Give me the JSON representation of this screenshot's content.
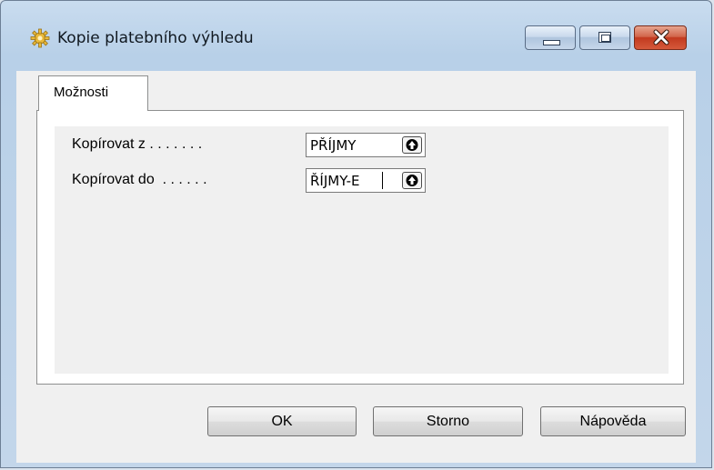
{
  "window": {
    "title": "Kopie platebního výhledu",
    "icon": "gear-icon",
    "controls": {
      "minimize": "minimize-icon",
      "maximize": "maximize-icon",
      "close": "close-icon"
    }
  },
  "tabs": [
    {
      "label": "Možnosti",
      "selected": true
    }
  ],
  "fields": {
    "copy_from": {
      "label": "Kopírovat z . . . . . . . ",
      "value": "PŘÍJMY"
    },
    "copy_to": {
      "label": "Kopírovat do  . . . . . . ",
      "value": "ŘÍJMY-E"
    }
  },
  "buttons": {
    "ok": "OK",
    "cancel": "Storno",
    "help": "Nápověda"
  },
  "colors": {
    "title_bar": "#b8d0e8",
    "close_button": "#c23a1f",
    "panel": "#f0f0f0"
  }
}
